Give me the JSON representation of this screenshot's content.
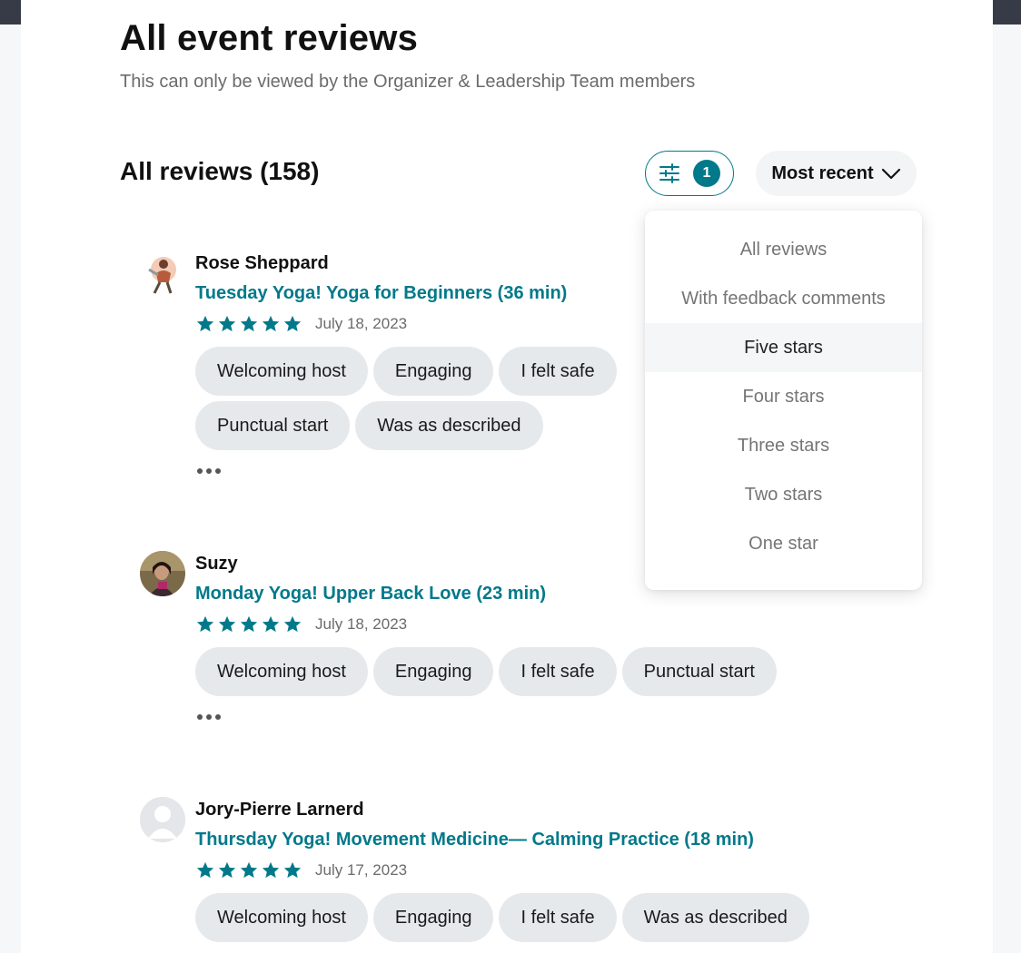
{
  "header": {
    "title": "All event reviews",
    "subtitle": "This can only be viewed by the Organizer & Leadership Team members"
  },
  "reviews_section": {
    "heading": "All reviews (158)",
    "filter_count": "1",
    "sort_label": "Most recent"
  },
  "dropdown": {
    "items": [
      {
        "label": "All reviews",
        "selected": false
      },
      {
        "label": "With feedback comments",
        "selected": false
      },
      {
        "label": "Five stars",
        "selected": true
      },
      {
        "label": "Four stars",
        "selected": false
      },
      {
        "label": "Three stars",
        "selected": false
      },
      {
        "label": "Two stars",
        "selected": false
      },
      {
        "label": "One star",
        "selected": false
      }
    ]
  },
  "reviews": [
    {
      "name": "Rose Sheppard",
      "event": "Tuesday Yoga! Yoga for Beginners (36 min)",
      "rating": 5,
      "date": "July 18, 2023",
      "tags": [
        "Welcoming host",
        "Engaging",
        "I felt safe",
        "Punctual start",
        "Was as described"
      ]
    },
    {
      "name": "Suzy",
      "event": "Monday Yoga! Upper Back Love (23 min)",
      "rating": 5,
      "date": "July 18, 2023",
      "tags": [
        "Welcoming host",
        "Engaging",
        "I felt safe",
        "Punctual start"
      ]
    },
    {
      "name": "Jory-Pierre Larnerd",
      "event": "Thursday Yoga! Movement Medicine— Calming Practice (18 min)",
      "rating": 5,
      "date": "July 17, 2023",
      "tags": [
        "Welcoming host",
        "Engaging",
        "I felt safe",
        "Was as described"
      ]
    }
  ],
  "colors": {
    "accent": "#00798a",
    "tag_bg": "#e6e9ec",
    "frame": "#373b47"
  }
}
